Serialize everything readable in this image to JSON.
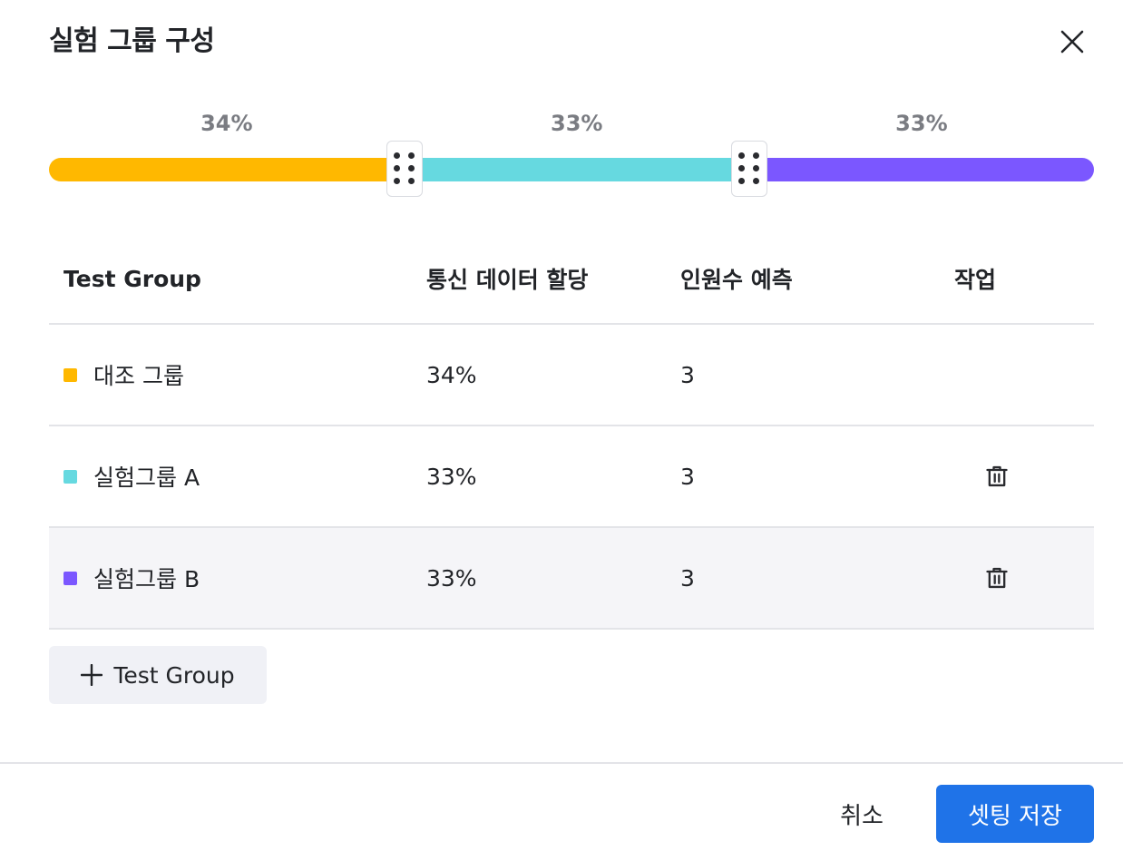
{
  "dialog": {
    "title": "실험 그룹 구성",
    "close_icon": "close-icon"
  },
  "slider": {
    "segments": [
      {
        "label": "34%",
        "percent": 34,
        "color": "#ffb800"
      },
      {
        "label": "33%",
        "percent": 33,
        "color": "#66d9e0"
      },
      {
        "label": "33%",
        "percent": 33,
        "color": "#7b57ff"
      }
    ],
    "handle_icon": "drag-handle-icon"
  },
  "table": {
    "headers": {
      "group": "Test Group",
      "allocation": "통신 데이터 할당",
      "estimate": "인원수 예측",
      "actions": "작업"
    },
    "rows": [
      {
        "name": "대조 그룹",
        "allocation": "34%",
        "estimate": "3",
        "color": "#ffb800",
        "deletable": false
      },
      {
        "name": "실험그룹 A",
        "allocation": "33%",
        "estimate": "3",
        "color": "#66d9e0",
        "deletable": true
      },
      {
        "name": "실험그룹 B",
        "allocation": "33%",
        "estimate": "3",
        "color": "#7b57ff",
        "deletable": true
      }
    ],
    "delete_icon": "trash-icon"
  },
  "add_group": {
    "label": "Test Group",
    "icon": "plus-icon"
  },
  "footer": {
    "cancel_label": "취소",
    "save_label": "셋팅 저장"
  }
}
